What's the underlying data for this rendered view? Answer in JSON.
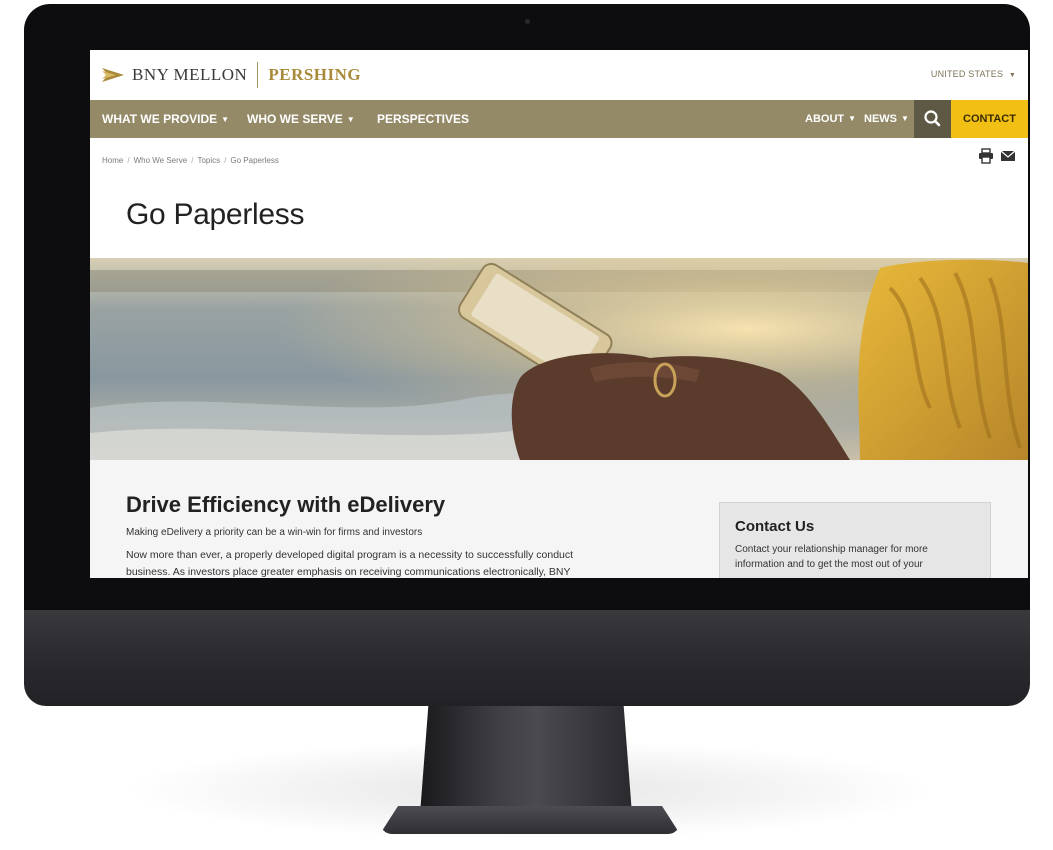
{
  "header": {
    "logo_primary": "BNY MELLON",
    "logo_secondary": "PERSHING",
    "country_selector": "UNITED STATES"
  },
  "nav": {
    "items": [
      {
        "label": "WHAT WE PROVIDE",
        "has_dropdown": true
      },
      {
        "label": "WHO WE SERVE",
        "has_dropdown": true
      },
      {
        "label": "PERSPECTIVES",
        "has_dropdown": false
      }
    ],
    "right_items": [
      {
        "label": "ABOUT",
        "has_dropdown": true
      },
      {
        "label": "NEWS",
        "has_dropdown": true
      }
    ],
    "search_icon": "search-icon",
    "contact_label": "CONTACT",
    "colors": {
      "bar": "#948a68",
      "search_bg": "#5e5945",
      "contact_bg": "#f2c014"
    }
  },
  "breadcrumb": [
    "Home",
    "Who We Serve",
    "Topics",
    "Go Paperless"
  ],
  "tools": [
    "print-icon",
    "email-icon"
  ],
  "page_title": "Go Paperless",
  "hero": {
    "image": "hand-holding-phone-beach-photo"
  },
  "content": {
    "heading": "Drive Efficiency with eDelivery",
    "subheading": "Making eDelivery a priority can be a win-win for firms and investors",
    "body_line_1": "Now more than ever, a properly developed digital program is a necessity to successfully conduct",
    "body_line_2": "business. As investors place greater emphasis on receiving communications electronically, BNY"
  },
  "sidebar": {
    "heading": "Contact Us",
    "line_1": "Contact your relationship manager for more",
    "line_2": "information and to get the most out of your"
  }
}
